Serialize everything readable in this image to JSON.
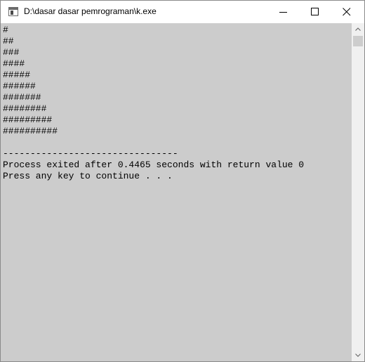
{
  "window": {
    "title": "D:\\dasar dasar pemrograman\\k.exe",
    "controls": {
      "minimize": "minimize-icon",
      "maximize": "maximize-icon",
      "close": "close-icon"
    }
  },
  "console": {
    "background": "#cccccc",
    "text_color": "#000000",
    "lines": [
      "#",
      "##",
      "###",
      "####",
      "#####",
      "######",
      "#######",
      "########",
      "#########",
      "##########",
      "",
      "--------------------------------",
      "Process exited after 0.4465 seconds with return value 0",
      "Press any key to continue . . ."
    ]
  }
}
